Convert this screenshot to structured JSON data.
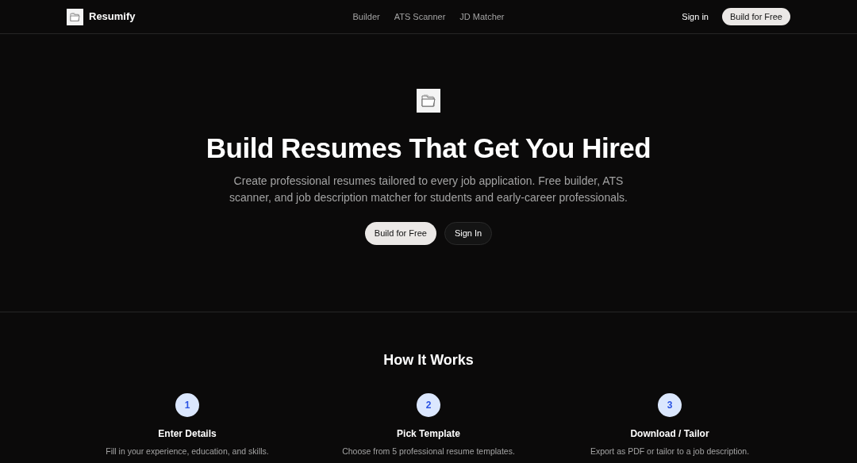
{
  "nav": {
    "brand": "Resumify",
    "links": [
      "Builder",
      "ATS Scanner",
      "JD Matcher"
    ],
    "sign_in": "Sign in",
    "cta": "Build for Free"
  },
  "hero": {
    "title": "Build Resumes That Get You Hired",
    "subtitle": "Create professional resumes tailored to every job application. Free builder, ATS scanner, and job description matcher for students and early-career professionals.",
    "primary": "Build for Free",
    "secondary": "Sign In"
  },
  "how": {
    "title": "How It Works",
    "steps": [
      {
        "number": "1",
        "title": "Enter Details",
        "text": "Fill in your experience, education, and skills."
      },
      {
        "number": "2",
        "title": "Pick Template",
        "text": "Choose from 5 professional resume templates."
      },
      {
        "number": "3",
        "title": "Download / Tailor",
        "text": "Export as PDF or tailor to a job description."
      }
    ]
  }
}
